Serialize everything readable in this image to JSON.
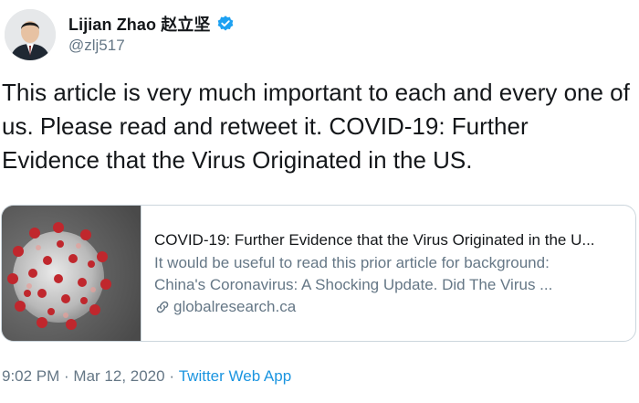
{
  "author": {
    "display_name": "Lijian Zhao 赵立坚",
    "handle": "@zlj517",
    "verified": true
  },
  "tweet": {
    "text": "This article is very much important to each and every one of us. Please read and retweet it. COVID-19: Further Evidence that the Virus Originated in the US."
  },
  "card": {
    "title": "COVID-19: Further Evidence that the Virus Originated in the U...",
    "description_line1": "It would be useful to read this prior article for background:",
    "description_line2": "China's Coronavirus: A Shocking Update. Did The Virus ...",
    "domain": "globalresearch.ca"
  },
  "meta": {
    "time": "9:02 PM",
    "separator1": " · ",
    "date": "Mar 12, 2020",
    "separator2": " · ",
    "source": "Twitter Web App"
  },
  "colors": {
    "text": "#14171a",
    "secondary": "#657786",
    "link": "#1b95e0",
    "verified": "#1da1f2",
    "border": "#ccd6dd"
  }
}
